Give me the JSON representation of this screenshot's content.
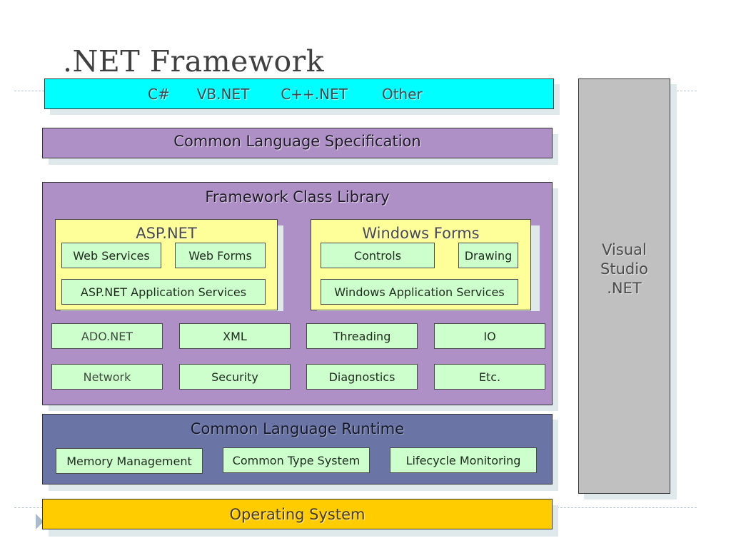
{
  "title": ".NET Framework",
  "languages": [
    "C#",
    "VB.NET",
    "C++.NET",
    "Other"
  ],
  "cls": "Common Language Specification",
  "fcl": {
    "title": "Framework Class Library",
    "aspnet": {
      "title": "ASP.NET",
      "items": [
        "Web Services",
        "Web Forms"
      ],
      "services": "ASP.NET Application Services"
    },
    "winforms": {
      "title": "Windows Forms",
      "items": [
        "Controls",
        "Drawing"
      ],
      "services": "Windows Application Services"
    },
    "grid": [
      "ADO.NET",
      "XML",
      "Threading",
      "IO",
      "Network",
      "Security",
      "Diagnostics",
      "Etc."
    ]
  },
  "clr": {
    "title": "Common Language Runtime",
    "items": [
      "Memory Management",
      "Common Type System",
      "Lifecycle Monitoring"
    ]
  },
  "os": "Operating System",
  "vs": {
    "line1": "Visual",
    "line2": "Studio",
    "line3": ".NET"
  },
  "colors": {
    "languages": "#00ffff",
    "cls": "#ae8fc6",
    "fcl": "#ae8fc6",
    "subgroup": "#ffff99",
    "component": "#ccffcc",
    "clr": "#6b75a5",
    "os": "#ffcc00",
    "vs": "#c0c0c0"
  }
}
